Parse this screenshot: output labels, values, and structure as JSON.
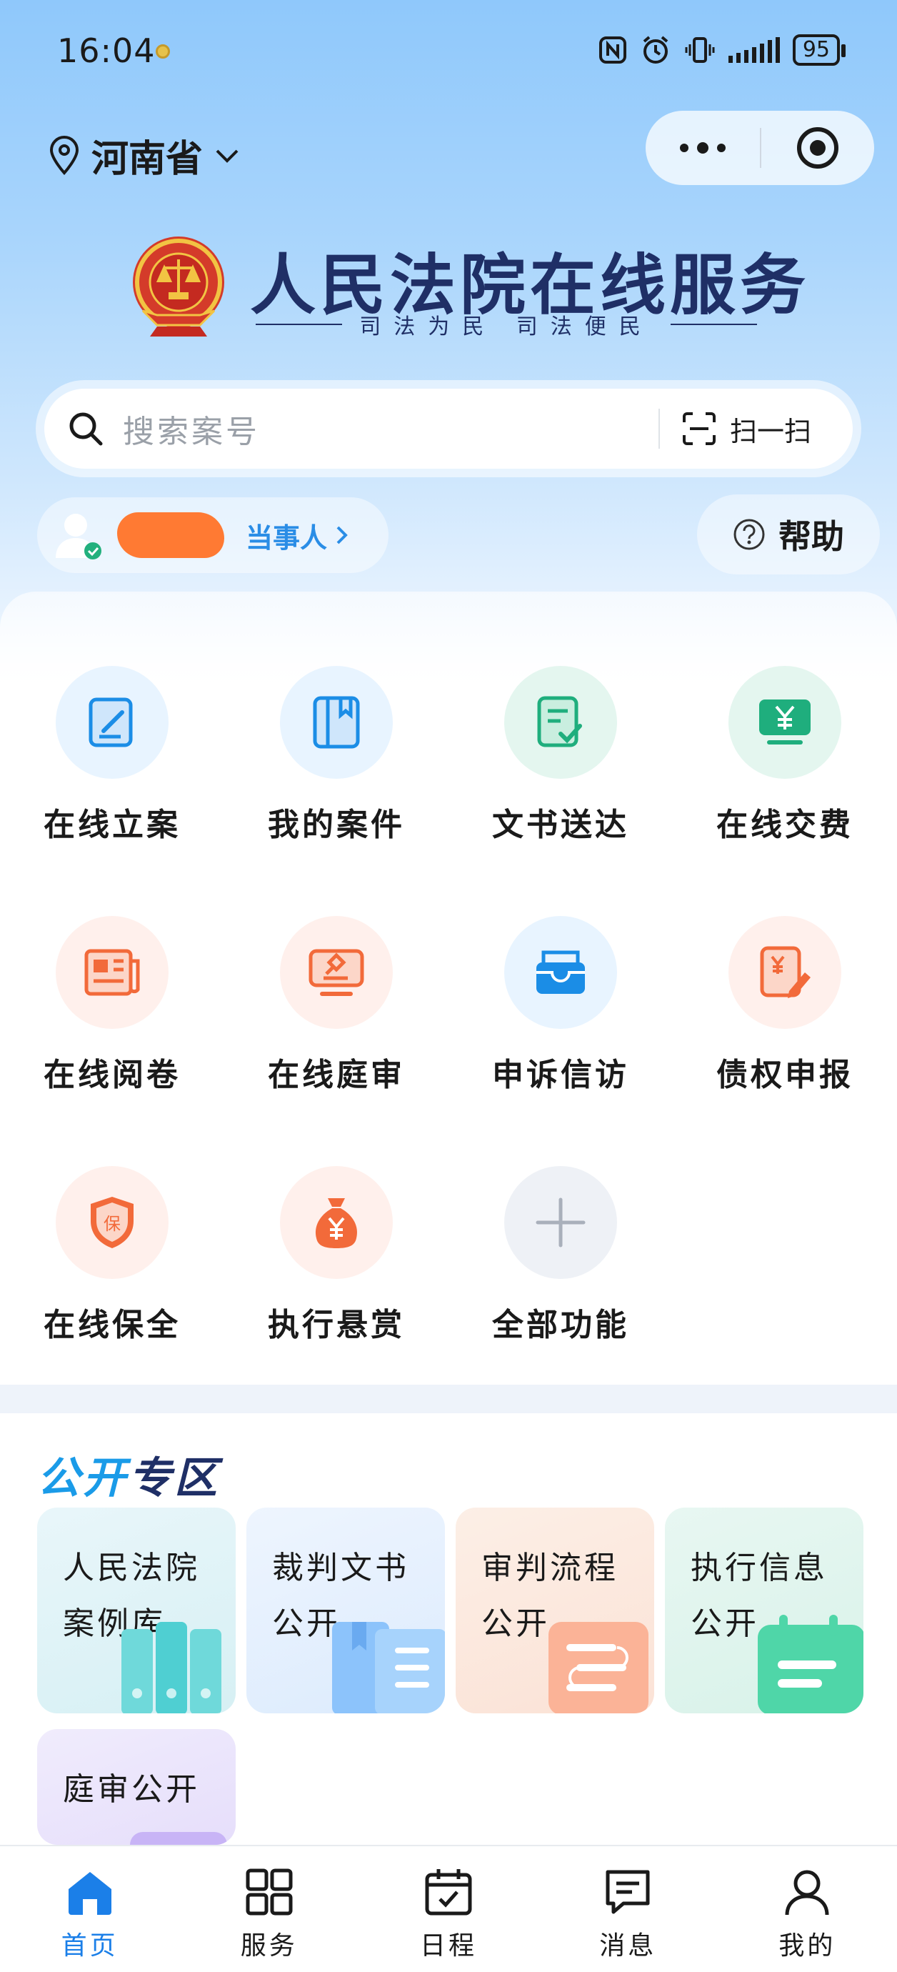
{
  "status_bar": {
    "time": "16:04",
    "battery": "95"
  },
  "location": {
    "label": "河南省"
  },
  "brand": {
    "title": "人民法院在线服务",
    "subtitle": "司法为民 司法便民"
  },
  "search": {
    "placeholder": "搜索案号",
    "scan_label": "扫一扫"
  },
  "user": {
    "role": "当事人"
  },
  "help": {
    "label": "帮助"
  },
  "grid": [
    {
      "label": "在线立案",
      "icon": "edit-form-icon"
    },
    {
      "label": "我的案件",
      "icon": "case-book-icon"
    },
    {
      "label": "文书送达",
      "icon": "document-check-icon"
    },
    {
      "label": "在线交费",
      "icon": "payment-screen-icon"
    },
    {
      "label": "在线阅卷",
      "icon": "newspaper-icon"
    },
    {
      "label": "在线庭审",
      "icon": "gavel-screen-icon"
    },
    {
      "label": "申诉信访",
      "icon": "mailbox-icon"
    },
    {
      "label": "债权申报",
      "icon": "claim-document-icon"
    },
    {
      "label": "在线保全",
      "icon": "shield-icon"
    },
    {
      "label": "执行悬赏",
      "icon": "money-bag-icon"
    },
    {
      "label": "全部功能",
      "icon": "plus-icon"
    }
  ],
  "public_zone": {
    "title_a": "公开",
    "title_b": "专区",
    "cards": [
      {
        "line1": "人民法院",
        "line2": "案例库"
      },
      {
        "line1": "裁判文书",
        "line2": "公开"
      },
      {
        "line1": "审判流程",
        "line2": "公开"
      },
      {
        "line1": "执行信息",
        "line2": "公开"
      },
      {
        "line1": "庭审公开",
        "line2": ""
      }
    ]
  },
  "tabs": [
    {
      "label": "首页",
      "icon": "home-icon"
    },
    {
      "label": "服务",
      "icon": "grid-icon"
    },
    {
      "label": "日程",
      "icon": "calendar-icon"
    },
    {
      "label": "消息",
      "icon": "message-icon"
    },
    {
      "label": "我的",
      "icon": "user-icon"
    }
  ],
  "colors": {
    "accent": "#1b7fe8",
    "brand": "#1f2f66",
    "orange": "#f26a3a",
    "teal": "#1fae7d"
  }
}
